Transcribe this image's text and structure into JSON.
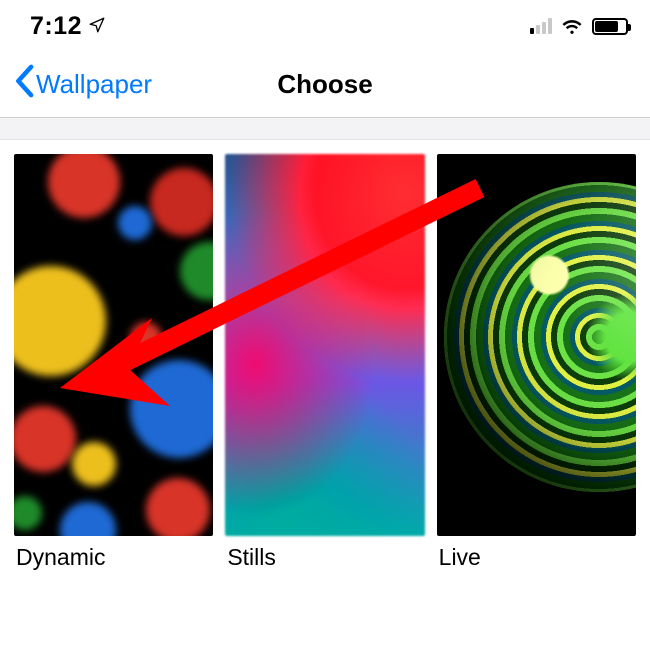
{
  "status": {
    "time": "7:12",
    "location_icon": "location-arrow-icon",
    "cell_strength": 1,
    "battery_pct": 78
  },
  "nav": {
    "back_label": "Wallpaper",
    "title": "Choose"
  },
  "grid": {
    "items": [
      {
        "label": "Dynamic",
        "kind": "dynamic"
      },
      {
        "label": "Stills",
        "kind": "stills"
      },
      {
        "label": "Live",
        "kind": "live"
      }
    ]
  },
  "annotation": {
    "target": "dynamic",
    "color": "#ff0000"
  }
}
